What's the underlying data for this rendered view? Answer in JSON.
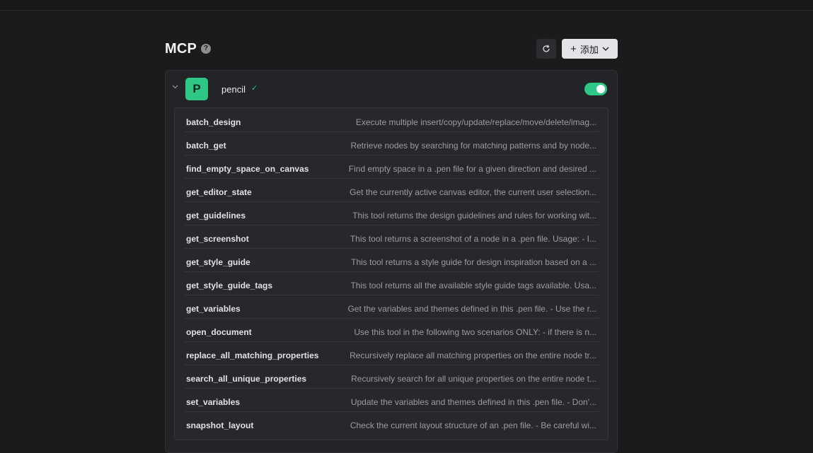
{
  "header": {
    "title": "MCP",
    "help_icon": "?",
    "refresh_icon": "refresh-icon",
    "add_label": "添加"
  },
  "server": {
    "logo_letter": "P",
    "name": "pencil",
    "status_icon": "✓",
    "enabled": true,
    "colors": {
      "accent": "#2fc785"
    }
  },
  "tools": [
    {
      "name": "batch_design",
      "description": "Execute multiple insert/copy/update/replace/move/delete/imag..."
    },
    {
      "name": "batch_get",
      "description": "Retrieve nodes by searching for matching patterns and by node..."
    },
    {
      "name": "find_empty_space_on_canvas",
      "description": "Find empty space in a .pen file for a given direction and desired ..."
    },
    {
      "name": "get_editor_state",
      "description": "Get the currently active canvas editor, the current user selection..."
    },
    {
      "name": "get_guidelines",
      "description": "This tool returns the design guidelines and rules for working wit..."
    },
    {
      "name": "get_screenshot",
      "description": "This tool returns a screenshot of a node in a .pen file. Usage: - I..."
    },
    {
      "name": "get_style_guide",
      "description": "This tool returns a style guide for design inspiration based on a ..."
    },
    {
      "name": "get_style_guide_tags",
      "description": "This tool returns all the available style guide tags available. Usa..."
    },
    {
      "name": "get_variables",
      "description": "Get the variables and themes defined in this .pen file. - Use the r..."
    },
    {
      "name": "open_document",
      "description": "Use this tool in the following two scenarios ONLY: - if there is n..."
    },
    {
      "name": "replace_all_matching_properties",
      "description": "Recursively replace all matching properties on the entire node tr..."
    },
    {
      "name": "search_all_unique_properties",
      "description": "Recursively search for all unique properties on the entire node t..."
    },
    {
      "name": "set_variables",
      "description": "Update the variables and themes defined in this .pen file. - Don'..."
    },
    {
      "name": "snapshot_layout",
      "description": "Check the current layout structure of an .pen file. - Be careful wi..."
    }
  ]
}
